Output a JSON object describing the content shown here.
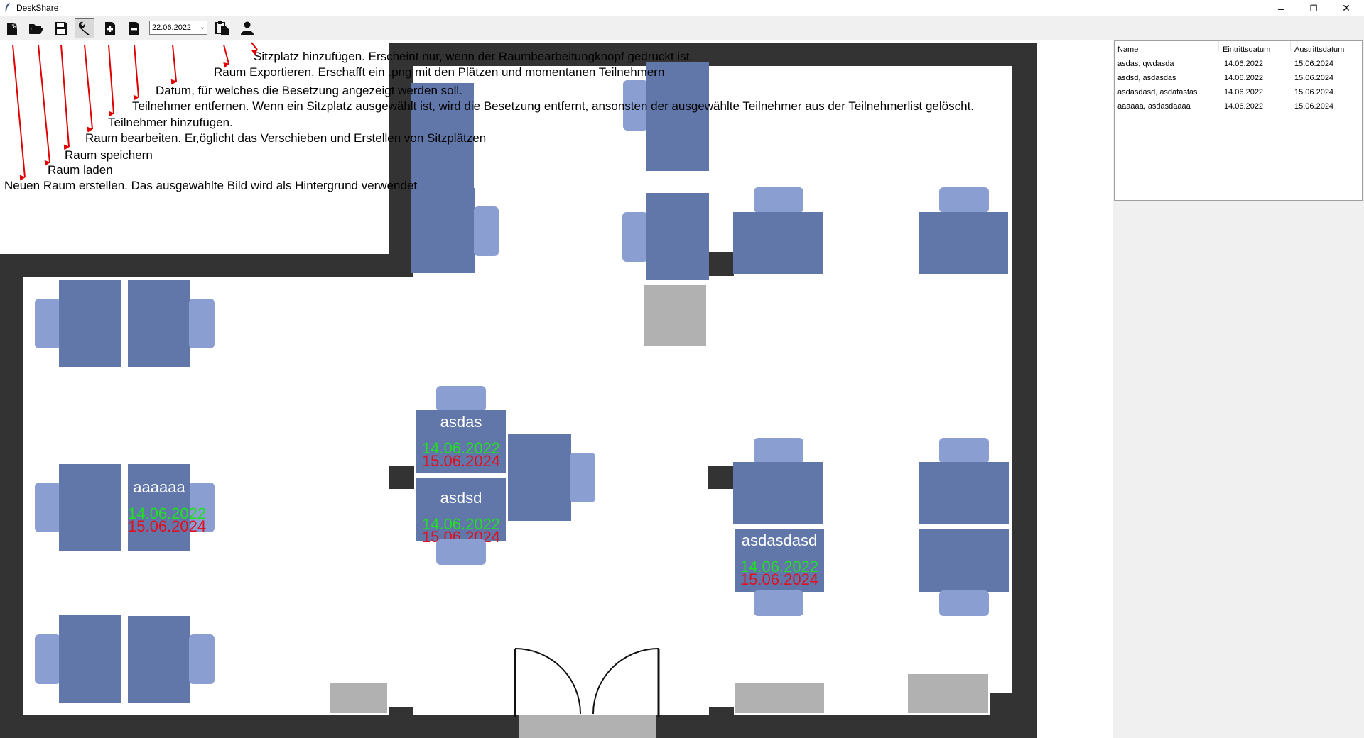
{
  "window": {
    "title": "DeskShare",
    "minimize": "–",
    "restore": "❐",
    "close": "✕"
  },
  "toolbar": {
    "date": "22.06.2022",
    "tools": [
      {
        "name": "new-room-icon"
      },
      {
        "name": "open-folder-icon"
      },
      {
        "name": "save-icon"
      },
      {
        "name": "wrench-icon"
      },
      {
        "name": "add-participant-icon"
      },
      {
        "name": "remove-participant-icon"
      },
      {
        "name": "export-clipboard-icon"
      },
      {
        "name": "add-seat-icon"
      }
    ]
  },
  "annotations": {
    "add_seat": "Sitzplatz hinzufügen. Erscheint nur, wenn der Raumbearbeitungknopf gedrückt ist.",
    "export": "Raum Exportieren. Erschafft ein .png mit den Plätzen und momentanen Teilnehmern",
    "date": "Datum, für welches die Besetzung angezeigt werden soll.",
    "remove": "Teilnehmer entfernen. Wenn ein Sitzplatz ausgewählt ist, wird die Besetzung entfernt, ansonsten der ausgewählte Teilnehmer aus der Teilnehmerlist gelöscht.",
    "add": "Teilnehmer hinzufügen.",
    "edit": "Raum bearbeiten. Er,öglicht das Verschieben und Erstellen von Sitzplätzen",
    "save": "Raum speichern",
    "load": "Raum laden",
    "new": "Neuen Raum erstellen. Das ausgewählte Bild wird als Hintergrund verwendet"
  },
  "desks": {
    "d1": {
      "name": "asdas",
      "start": "14.06.2022",
      "end": "15.06.2024"
    },
    "d2": {
      "name": "asdsd",
      "start": "14.06.2022",
      "end": "15.06.2024"
    },
    "d3": {
      "name": "aaaaaa",
      "start": "14.06.2022",
      "end": "15.06.2024"
    },
    "d4": {
      "name": "asdasdasd",
      "start": "14.06.2022",
      "end": "15.06.2024"
    }
  },
  "participants": {
    "headers": [
      "Name",
      "Eintrittsdatum",
      "Austrittsdatum"
    ],
    "rows": [
      {
        "name": "asdas, qwdasda",
        "start": "14.06.2022",
        "end": "15.06.2024"
      },
      {
        "name": "asdsd, asdasdas",
        "start": "14.06.2022",
        "end": "15.06.2024"
      },
      {
        "name": "asdasdasd, asdafasfas",
        "start": "14.06.2022",
        "end": "15.06.2024"
      },
      {
        "name": "aaaaaa, asdasdaaaa",
        "start": "14.06.2022",
        "end": "15.06.2024"
      }
    ]
  },
  "colors": {
    "desk": "#6176a9",
    "chair": "#8a9ed1",
    "wall": "#333333",
    "start_date": "#20e020",
    "end_date": "#e01020"
  }
}
